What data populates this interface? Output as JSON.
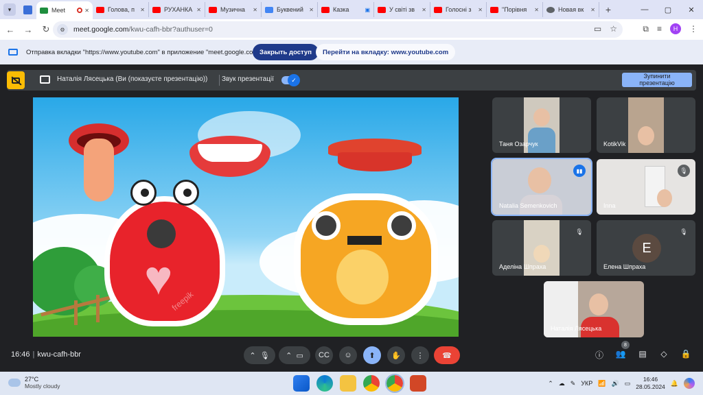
{
  "browser": {
    "tabs": [
      {
        "label": "Meet",
        "favicon_color": "#1e8e3e",
        "active": true,
        "recording": true
      },
      {
        "label": "Голова, п",
        "favicon_color": "#ff0000"
      },
      {
        "label": "РУХАНКА",
        "favicon_color": "#ff0000"
      },
      {
        "label": "Музична",
        "favicon_color": "#ff0000"
      },
      {
        "label": "Буквений",
        "favicon_color": "#4285f4"
      },
      {
        "label": "Казка",
        "favicon_color": "#ff0000"
      },
      {
        "label": "У світі зв",
        "favicon_color": "#ff0000"
      },
      {
        "label": "Голосні з",
        "favicon_color": "#ff0000"
      },
      {
        "label": "\"Порівня",
        "favicon_color": "#ff0000"
      },
      {
        "label": "Новая вк",
        "favicon_color": "#5f6368"
      }
    ],
    "new_tab": "+",
    "window_controls": {
      "minimize": "—",
      "maximize": "▢",
      "close": "✕"
    },
    "url_host": "meet.google.com",
    "url_path": "/kwu-cafh-bbr?authuser=0",
    "profile_initial": "Н"
  },
  "share_notification": {
    "message": "Отправка вкладки \"https://www.youtube.com\" в приложение \"meet.google.com\"...",
    "stop_button": "Закрыть доступ",
    "switch_button": "Перейти на вкладку: www.youtube.com"
  },
  "presenter_bar": {
    "presenter_text": "Наталія Лясецька (Ви (показуєте презентацію))",
    "sound_label": "Звук презентації",
    "sound_on": true,
    "stop_button_line1": "Зупинити",
    "stop_button_line2": "презентацію"
  },
  "presentation": {
    "watermark": "freepik"
  },
  "participants": [
    {
      "name": "Таня Озарчук",
      "muted": false,
      "video": true
    },
    {
      "name": "KotikVik",
      "muted": false,
      "video": true
    },
    {
      "name": "Natalia Semenkovich",
      "muted": false,
      "video": true,
      "speaking": true
    },
    {
      "name": "Inna",
      "muted": true,
      "video": true
    },
    {
      "name": "Аделіна Шпраха",
      "muted": true,
      "video": true
    },
    {
      "name": "Елена Шпраха",
      "muted": true,
      "video": false,
      "avatar_initial": "E",
      "avatar_color": "#5b4a40"
    },
    {
      "name": "Наталія Лясецька",
      "muted": false,
      "video": true,
      "self": true
    }
  ],
  "meeting": {
    "time": "16:46",
    "code": "kwu-cafh-bbr",
    "participant_count": "8"
  },
  "taskbar": {
    "temperature": "27°C",
    "weather": "Mostly cloudy",
    "language": "УКР",
    "time": "16:46",
    "date": "28.05.2024"
  },
  "colors": {
    "meet_bg": "#202124",
    "accent": "#8ab4f8",
    "leave": "#ea4335",
    "presenter_badge": "#fbbc04"
  }
}
